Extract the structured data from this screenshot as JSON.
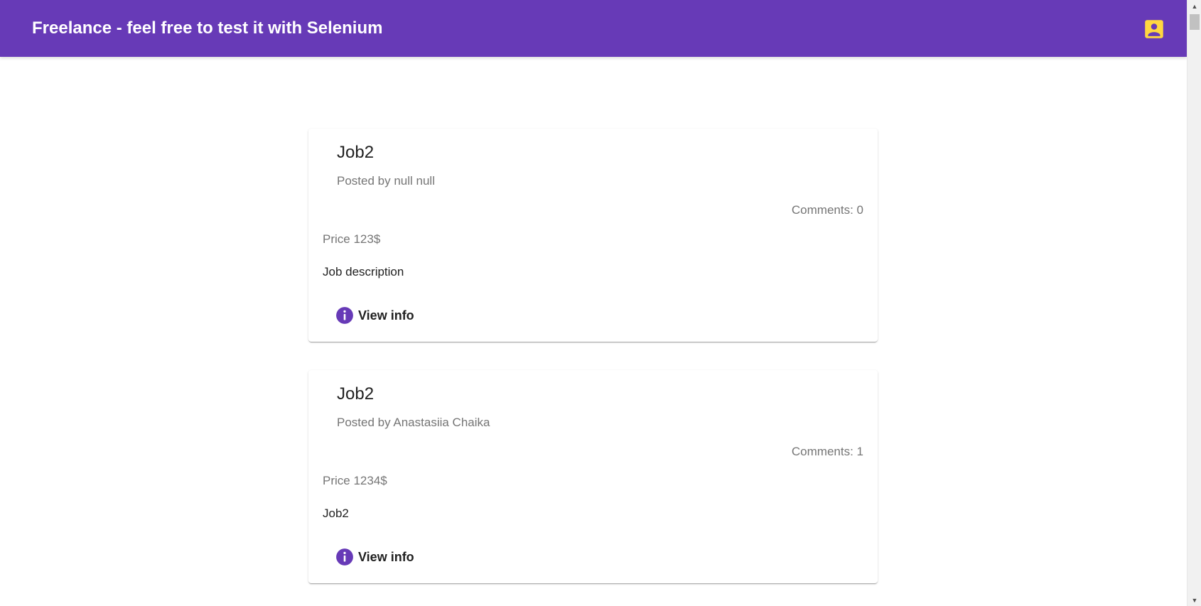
{
  "header": {
    "title": "Freelance - feel free to test it with Selenium",
    "account_icon": "account-box-icon",
    "background_color": "#673ab7",
    "icon_color": "#ffd740"
  },
  "jobs": [
    {
      "title": "Job2",
      "posted_by": "Posted by null null",
      "comments": "Comments: 0",
      "price": "Price 123$",
      "description": "Job description",
      "view_info_label": "View info",
      "view_info_icon": "info-icon"
    },
    {
      "title": "Job2",
      "posted_by": "Posted by Anastasiia Chaika",
      "comments": "Comments: 1",
      "price": "Price 1234$",
      "description": "Job2",
      "view_info_label": "View info",
      "view_info_icon": "info-icon"
    }
  ],
  "colors": {
    "accent": "#673ab7",
    "title_text": "#212121",
    "secondary_text": "#757575"
  }
}
